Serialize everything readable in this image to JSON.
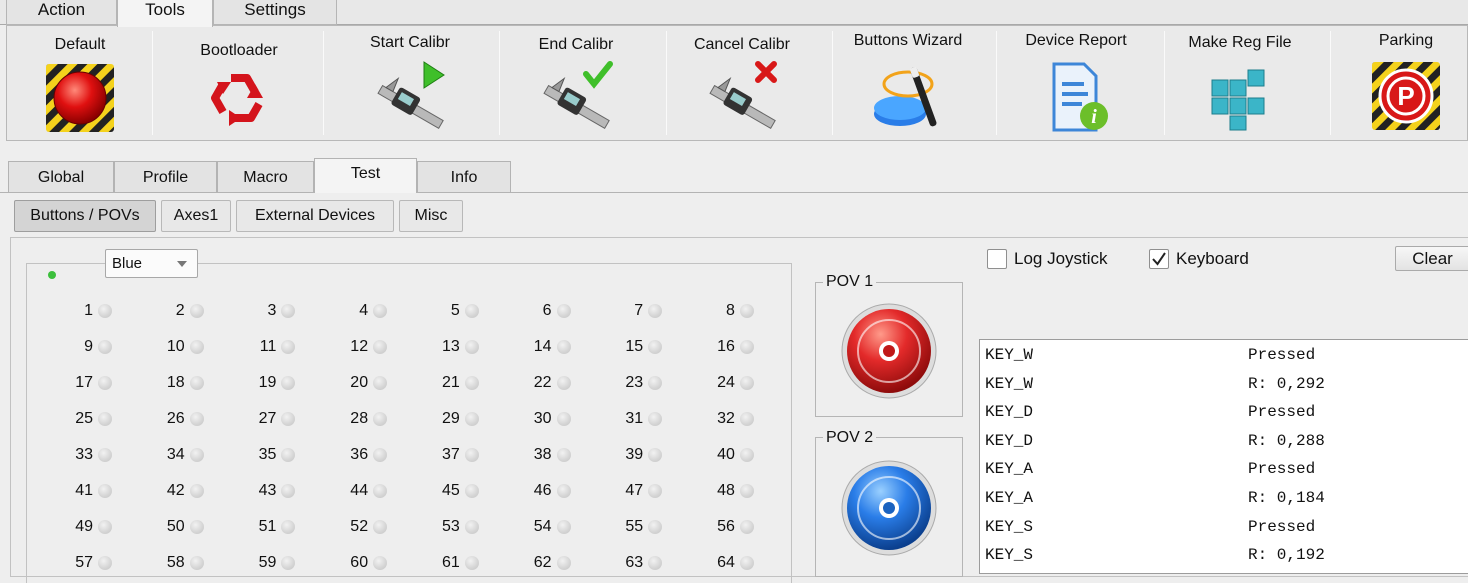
{
  "menu_tabs": [
    "Action",
    "Tools",
    "Settings"
  ],
  "menu_active": "Tools",
  "tools": [
    {
      "label": "Default",
      "icon": "red-alarm-button-icon"
    },
    {
      "label": "Bootloader",
      "icon": "recycle-icon"
    },
    {
      "label": "Start Calibr",
      "icon": "caliper-play-icon"
    },
    {
      "label": "End Calibr",
      "icon": "caliper-check-icon"
    },
    {
      "label": "Cancel Calibr",
      "icon": "caliper-cancel-icon"
    },
    {
      "label": "Buttons Wizard",
      "icon": "button-wand-icon"
    },
    {
      "label": "Device Report",
      "icon": "document-info-icon"
    },
    {
      "label": "Make Reg File",
      "icon": "registry-cubes-icon"
    },
    {
      "label": "Parking",
      "icon": "parking-sign-icon"
    }
  ],
  "panel_tabs": [
    "Global",
    "Profile",
    "Macro",
    "Test",
    "Info"
  ],
  "panel_active": "Test",
  "sub_tabs": [
    "Buttons / POVs",
    "Axes1",
    "External Devices",
    "Misc"
  ],
  "sub_active": "Buttons / POVs",
  "color_select": "Blue",
  "buttons": [
    "1",
    "2",
    "3",
    "4",
    "5",
    "6",
    "7",
    "8",
    "9",
    "10",
    "11",
    "12",
    "13",
    "14",
    "15",
    "16",
    "17",
    "18",
    "19",
    "20",
    "21",
    "22",
    "23",
    "24",
    "25",
    "26",
    "27",
    "28",
    "29",
    "30",
    "31",
    "32",
    "33",
    "34",
    "35",
    "36",
    "37",
    "38",
    "39",
    "40",
    "41",
    "42",
    "43",
    "44",
    "45",
    "46",
    "47",
    "48",
    "49",
    "50",
    "51",
    "52",
    "53",
    "54",
    "55",
    "56",
    "57",
    "58",
    "59",
    "60",
    "61",
    "62",
    "63",
    "64"
  ],
  "pov1": {
    "label": "POV 1",
    "color": "#e32a2a"
  },
  "pov2": {
    "label": "POV 2",
    "color": "#2a7de8"
  },
  "log_joystick": {
    "label": "Log Joystick",
    "checked": false
  },
  "keyboard": {
    "label": "Keyboard",
    "checked": true
  },
  "clear_label": "Clear",
  "log": [
    {
      "key": "KEY_W",
      "value": "Pressed"
    },
    {
      "key": "KEY_W",
      "value": "R: 0,292"
    },
    {
      "key": "KEY_D",
      "value": "Pressed"
    },
    {
      "key": "KEY_D",
      "value": "R: 0,288"
    },
    {
      "key": "KEY_A",
      "value": "Pressed"
    },
    {
      "key": "KEY_A",
      "value": "R: 0,184"
    },
    {
      "key": "KEY_S",
      "value": "Pressed"
    },
    {
      "key": "KEY_S",
      "value": "R: 0,192"
    }
  ],
  "colors": {
    "indicator_green": "#3cbf3c",
    "led_off": "#d0d0d0"
  }
}
